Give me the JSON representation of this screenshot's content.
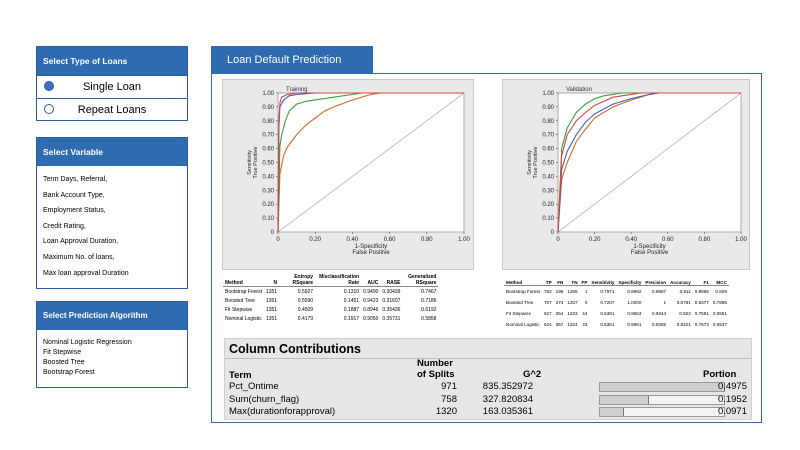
{
  "loan_type_panel": {
    "title": "Select Type of Loans",
    "options": [
      {
        "label": "Single Loan",
        "selected": true
      },
      {
        "label": "Repeat Loans",
        "selected": false
      }
    ]
  },
  "variable_panel": {
    "title": "Select Variable",
    "items": [
      "Term Days, Referral,",
      "Bank Account Type,",
      "Employment Status,",
      "Credit Rating,",
      "Loan Approval Duration,",
      "Maximum No. of loans,",
      "Max loan approval Duration"
    ]
  },
  "algorithm_panel": {
    "title": "Select Prediction Algorithm",
    "items": [
      "Nominal Logistic Regression",
      "Fit Stepwise",
      "Boosted Tree",
      "Bootstrap Forest"
    ]
  },
  "main": {
    "title": "Loan Default Prediction"
  },
  "chart_data": [
    {
      "type": "line",
      "title": "Training",
      "xlabel": "1-Specificity\nFalse Positive",
      "ylabel": "Sensitivity\nTrue Positive",
      "xlim": [
        0,
        1
      ],
      "ylim": [
        0,
        1
      ],
      "xticks": [
        "0",
        "0.20",
        "0.40",
        "0.60",
        "0.80",
        "1.00"
      ],
      "yticks": [
        "0",
        "0.10",
        "0.20",
        "0.30",
        "0.40",
        "0.50",
        "0.60",
        "0.70",
        "0.80",
        "0.90",
        "1.00"
      ],
      "colors": [
        "#d9453a",
        "#3d5fc4",
        "#3aa03a",
        "#d06a23"
      ],
      "series": [
        {
          "x": [
            0,
            0.005,
            0.01,
            0.02,
            0.05,
            0.1,
            0.2,
            1
          ],
          "y": [
            0,
            0.8,
            0.93,
            0.97,
            0.99,
            1,
            1,
            1
          ]
        },
        {
          "x": [
            0,
            0.005,
            0.01,
            0.03,
            0.06,
            0.1,
            0.2,
            1
          ],
          "y": [
            0,
            0.75,
            0.9,
            0.95,
            0.98,
            0.99,
            1,
            1
          ]
        },
        {
          "x": [
            0,
            0.01,
            0.02,
            0.04,
            0.06,
            0.1,
            0.15,
            0.25,
            0.35,
            0.45,
            1
          ],
          "y": [
            0,
            0.62,
            0.7,
            0.8,
            0.87,
            0.92,
            0.94,
            0.96,
            0.98,
            1,
            1
          ]
        },
        {
          "x": [
            0,
            0.01,
            0.03,
            0.05,
            0.1,
            0.15,
            0.2,
            0.25,
            0.3,
            0.4,
            0.5,
            0.55,
            1
          ],
          "y": [
            0,
            0.42,
            0.55,
            0.61,
            0.7,
            0.77,
            0.82,
            0.87,
            0.9,
            0.95,
            0.99,
            1,
            1
          ]
        }
      ]
    },
    {
      "type": "line",
      "title": "Validation",
      "xlabel": "1-Specificity\nFalse Positive",
      "ylabel": "Sensitivity\nTrue Positive",
      "xlim": [
        0,
        1
      ],
      "ylim": [
        0,
        1
      ],
      "xticks": [
        "0",
        "0.20",
        "0.40",
        "0.60",
        "0.80",
        "1.00"
      ],
      "yticks": [
        "0",
        "0.10",
        "0.20",
        "0.30",
        "0.40",
        "0.50",
        "0.60",
        "0.70",
        "0.80",
        "0.90",
        "1.00"
      ],
      "colors": [
        "#d9453a",
        "#3d5fc4",
        "#3aa03a",
        "#d06a23"
      ],
      "series": [
        {
          "x": [
            0,
            0.02,
            0.05,
            0.1,
            0.15,
            0.2,
            0.3,
            0.4,
            0.45,
            1
          ],
          "y": [
            0,
            0.55,
            0.7,
            0.8,
            0.86,
            0.91,
            0.97,
            0.99,
            1,
            1
          ]
        },
        {
          "x": [
            0,
            0.02,
            0.05,
            0.1,
            0.15,
            0.2,
            0.3,
            0.4,
            0.5,
            0.55,
            1
          ],
          "y": [
            0,
            0.45,
            0.58,
            0.7,
            0.79,
            0.85,
            0.92,
            0.96,
            0.99,
            1,
            1
          ]
        },
        {
          "x": [
            0,
            0.02,
            0.05,
            0.1,
            0.15,
            0.2,
            0.25,
            0.3,
            0.35,
            1
          ],
          "y": [
            0,
            0.6,
            0.75,
            0.86,
            0.92,
            0.96,
            0.98,
            0.99,
            1,
            1
          ]
        },
        {
          "x": [
            0,
            0.02,
            0.05,
            0.1,
            0.15,
            0.2,
            0.3,
            0.4,
            0.5,
            0.55,
            1
          ],
          "y": [
            0,
            0.38,
            0.5,
            0.65,
            0.74,
            0.82,
            0.9,
            0.95,
            0.99,
            1,
            1
          ]
        }
      ]
    }
  ],
  "training_table": {
    "headers": [
      [
        "Method",
        "N",
        "Entropy RSquare",
        "Misclassification Rate",
        "AUC",
        "RASE",
        "Generalized RSquare"
      ]
    ],
    "rows": [
      [
        "Bootstrap Forest",
        "1351",
        "0.5927",
        "0.1310",
        "0.9490",
        "0.30439",
        "0.7467"
      ],
      [
        "Boosted Tree",
        "1351",
        "0.5590",
        "0.1451",
        "0.9423",
        "0.31607",
        "0.7186"
      ],
      [
        "Fit Stepwise",
        "1351",
        "0.4509",
        "0.1887",
        "0.8946",
        "0.35436",
        "0.6192"
      ],
      [
        "Nominal Logistic",
        "1351",
        "0.4179",
        "0.1917",
        "0.9050",
        "0.35731",
        "0.5858"
      ]
    ]
  },
  "validation_table": {
    "headers": [
      "Method",
      "TP",
      "FN",
      "TN",
      "FP",
      "Sensitivity",
      "Specificity",
      "Precision",
      "Accuracy",
      "F1",
      "MCC"
    ],
    "rows": [
      [
        "Bootstrap Forest",
        "782",
        "199",
        "1266",
        "1",
        "0.7971",
        "0.9992",
        "0.9987",
        "0.911",
        "0.8866",
        "0.829"
      ],
      [
        "Boosted Tree",
        "707",
        "274",
        "1267",
        "0",
        "0.7207",
        "1.0000",
        "1",
        "0.8781",
        "0.8377",
        "0.7696"
      ],
      [
        "Fit Stepwise",
        "627",
        "354",
        "1223",
        "44",
        "0.6391",
        "0.9653",
        "0.9344",
        "0.823",
        "0.7591",
        "0.6551"
      ],
      [
        "Nominal Logistic",
        "624",
        "357",
        "1224",
        "43",
        "0.6361",
        "0.9661",
        "0.9355",
        "0.8221",
        "0.7573",
        "0.6537"
      ]
    ]
  },
  "column_contributions": {
    "title": "Column Contributions",
    "headers": {
      "term": "Term",
      "splits1": "Number",
      "splits2": "of Splits",
      "g2": "G^2",
      "portion": "Portion"
    },
    "rows": [
      {
        "term": "Pct_Ontime",
        "splits": "971",
        "g2": "835.352972",
        "portion": "0.4975",
        "fraction": 0.4975
      },
      {
        "term": "Sum(churn_flag)",
        "splits": "758",
        "g2": "327.820834",
        "portion": "0.1952",
        "fraction": 0.1952
      },
      {
        "term": "Max(durationforapproval)",
        "splits": "1320",
        "g2": "163.035361",
        "portion": "0.0971",
        "fraction": 0.0971
      }
    ]
  }
}
